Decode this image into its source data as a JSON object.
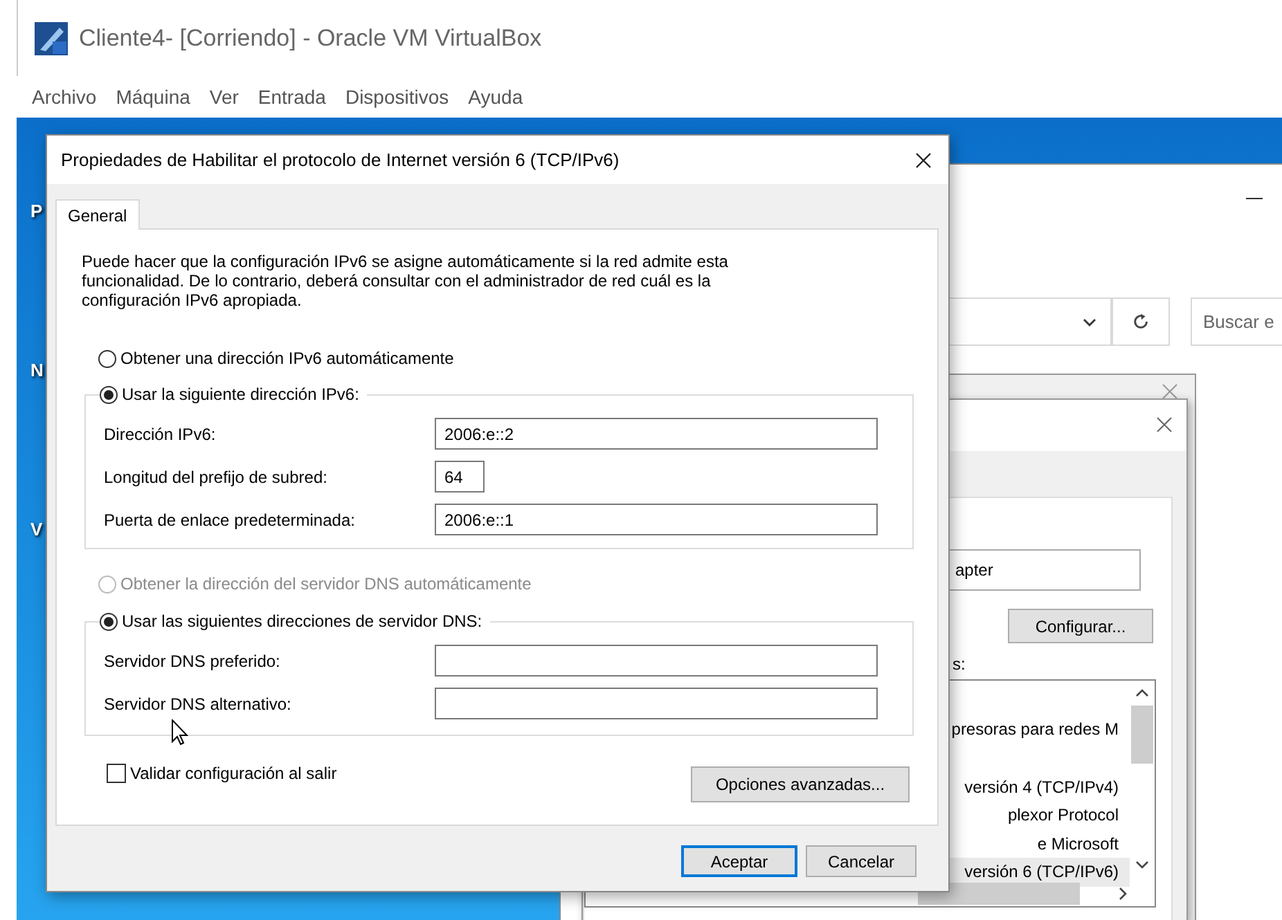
{
  "host_window": {
    "title": "Cliente4- [Corriendo] - Oracle VM VirtualBox",
    "menu": [
      "Archivo",
      "Máquina",
      "Ver",
      "Entrada",
      "Dispositivos",
      "Ayuda"
    ]
  },
  "desktop_icons": [
    {
      "label": "P"
    },
    {
      "label": "N"
    },
    {
      "label": "V"
    }
  ],
  "explorer_window": {
    "search": {
      "placeholder": "Buscar e"
    }
  },
  "adapter_dialog": {
    "adapter_field": "apter",
    "configure_button": "Configurar...",
    "list_label": "s:",
    "items": [
      {
        "label": "presoras para redes M",
        "selected": false
      },
      {
        "label": "versión 4 (TCP/IPv4)",
        "selected": false
      },
      {
        "label": "plexor Protocol",
        "selected": false
      },
      {
        "label": "e Microsoft",
        "selected": false
      },
      {
        "label": "versión 6 (TCP/IPv6)",
        "selected": true
      }
    ]
  },
  "dialog": {
    "title": "Propiedades de Habilitar el protocolo de Internet versión 6 (TCP/IPv6)",
    "tabs": [
      {
        "label": "General",
        "selected": true
      }
    ],
    "intro": "Puede hacer que la configuración IPv6 se asigne automáticamente si la red admite esta funcionalidad. De lo contrario, deberá consultar con el administrador de red cuál es la configuración IPv6 apropiada.",
    "address_options": [
      {
        "label": "Obtener una dirección IPv6 automáticamente",
        "selected": false,
        "disabled": false
      },
      {
        "label": "Usar la siguiente dirección IPv6:",
        "selected": true,
        "disabled": false
      }
    ],
    "address_fields": [
      {
        "label": "Dirección IPv6:",
        "value": "2006:e::2",
        "kind": "address"
      },
      {
        "label": "Longitud del prefijo de subred:",
        "value": "64",
        "kind": "prefix"
      },
      {
        "label": "Puerta de enlace predeterminada:",
        "value": "2006:e::1",
        "kind": "address"
      }
    ],
    "dns_options": [
      {
        "label": "Obtener la dirección del servidor DNS automáticamente",
        "selected": false,
        "disabled": true
      },
      {
        "label": "Usar las siguientes direcciones de servidor DNS:",
        "selected": true,
        "disabled": false
      }
    ],
    "dns_fields": [
      {
        "label": "Servidor DNS preferido:",
        "kind": "address"
      },
      {
        "label": "Servidor DNS alternativo:",
        "kind": "address"
      }
    ],
    "validate": {
      "label": "Validar configuración al salir",
      "checked": false
    },
    "advanced_button": "Opciones avanzadas...",
    "buttons": [
      {
        "label": "Aceptar",
        "kind": "default"
      },
      {
        "label": "Cancelar",
        "kind": "normal"
      }
    ]
  }
}
